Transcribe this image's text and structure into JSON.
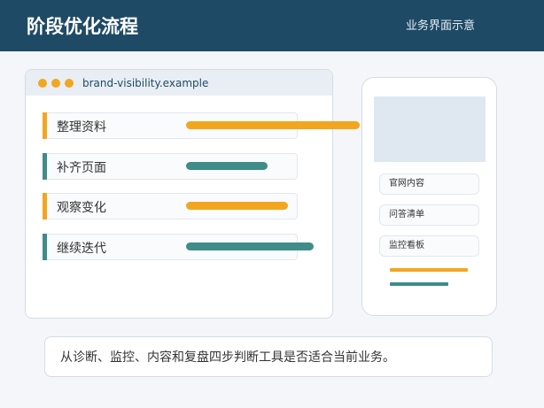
{
  "header": {
    "title": "阶段优化流程",
    "subtitle": "业务界面示意"
  },
  "browser": {
    "url": "brand-visibility.example"
  },
  "steps": [
    {
      "label": "整理资料",
      "progress": 0.68,
      "color": "#f2a61f"
    },
    {
      "label": "补齐页面",
      "progress": 0.32,
      "color": "#3f8c88"
    },
    {
      "label": "观察变化",
      "progress": 0.4,
      "color": "#f2a61f"
    },
    {
      "label": "继续迭代",
      "progress": 0.5,
      "color": "#3f8c88"
    }
  ],
  "phone": {
    "items": [
      "官网内容",
      "问答清单",
      "监控看板"
    ],
    "lines": [
      {
        "color": "#f2a61f"
      },
      {
        "color": "#3f8c88"
      }
    ]
  },
  "note": {
    "text": "从诊断、监控、内容和复盘四步判断工具是否适合当前业务。"
  },
  "colors": {
    "header_bg": "#1f4a66",
    "accent_orange": "#f2a61f",
    "accent_teal": "#3f8c88"
  }
}
